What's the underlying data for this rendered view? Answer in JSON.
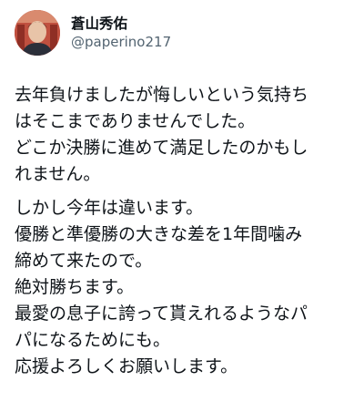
{
  "author": {
    "display_name": "蒼山秀佑",
    "handle": "@paperino217",
    "avatar_icon": "user-avatar-photo"
  },
  "tweet": {
    "paragraphs": [
      {
        "lines": [
          "去年負けましたが悔しいという気持ち",
          "はそこまでありませんでした。",
          "どこか決勝に進めて満足したのかもし",
          "れません。"
        ]
      },
      {
        "lines": [
          "しかし今年は違います。",
          "優勝と準優勝の大きな差を1年間噛み",
          "締めて来たので。",
          "絶対勝ちます。",
          "最愛の息子に誇って貰えれるようなパ",
          "パになるためにも。",
          "応援よろしくお願いします。"
        ]
      }
    ]
  },
  "colors": {
    "text": "#0f1419",
    "secondary_text": "#536471",
    "background": "#ffffff"
  }
}
